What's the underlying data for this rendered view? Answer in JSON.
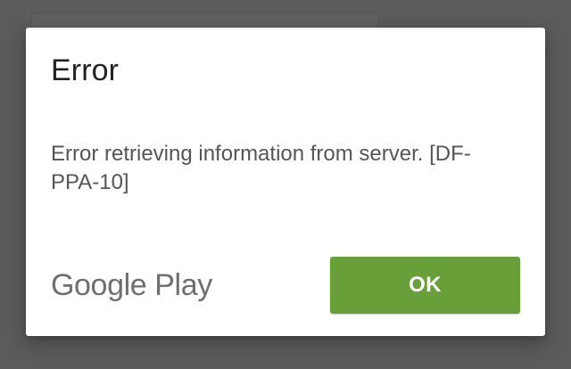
{
  "dialog": {
    "title": "Error",
    "message": "Error retrieving information from server. [DF-PPA-10]",
    "footer_logo_text": "Google Play",
    "ok_button_label": "OK"
  },
  "colors": {
    "overlay_background": "#5b5b5b",
    "dialog_background": "#ffffff",
    "ok_button_background": "#689f38",
    "ok_button_text": "#ffffff",
    "title_text": "#222222",
    "message_text": "#555555",
    "logo_text": "#6f6f6f"
  }
}
